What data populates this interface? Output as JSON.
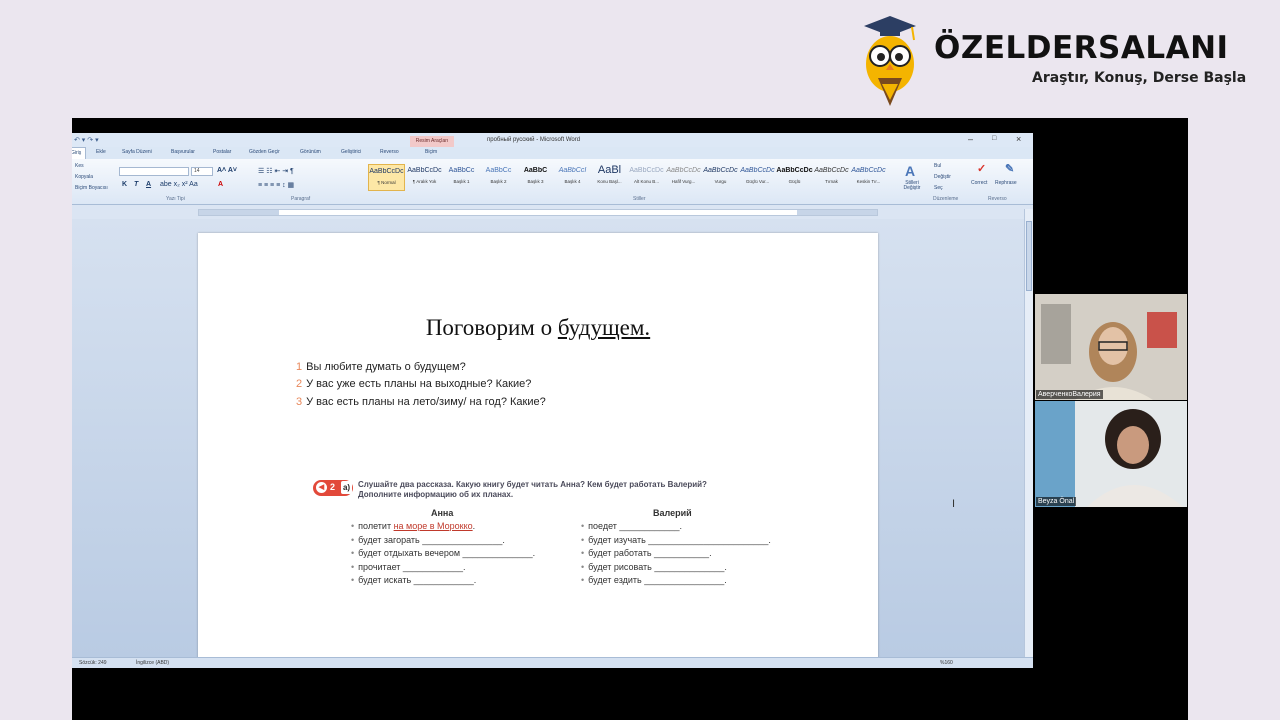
{
  "brand": {
    "name": "ÖZELDERSALANI",
    "tagline": "Araştır, Konuş, Derse Başla"
  },
  "word": {
    "title": "пробный русский - Microsoft Word",
    "context_tab": "Resim Araçları",
    "tabs": [
      "Giriş",
      "Ekle",
      "Sayfa Düzeni",
      "Başvurular",
      "Postalar",
      "Gözden Geçir",
      "Görünüm",
      "Geliştirici",
      "Reverso",
      "Biçim"
    ],
    "clipboard": [
      "Kes",
      "Kopyala",
      "Biçim Boyacısı"
    ],
    "font_size": "14",
    "groups": [
      "Yazı Tipi",
      "Paragraf",
      "Stiller",
      "Düzenleme",
      "Reverso"
    ],
    "styles": [
      {
        "sample": "AaBbCcDc",
        "name": "¶ Normal"
      },
      {
        "sample": "AaBbCcDc",
        "name": "¶ Aralık Yok"
      },
      {
        "sample": "AaBbCc",
        "name": "Başlık 1"
      },
      {
        "sample": "AaBbCc",
        "name": "Başlık 2"
      },
      {
        "sample": "AaBbC",
        "name": "Başlık 3"
      },
      {
        "sample": "AaBbCcI",
        "name": "Başlık 4"
      },
      {
        "sample": "AaBl",
        "name": "Konu Başl..."
      },
      {
        "sample": "AaBbCcDc",
        "name": "Alt Konu B..."
      },
      {
        "sample": "AaBbCcDc",
        "name": "Hafif Vurg..."
      },
      {
        "sample": "AaBbCcDc",
        "name": "Vurgu"
      },
      {
        "sample": "AaBbCcDc",
        "name": "Güçlü Vur..."
      },
      {
        "sample": "AaBbCcDc",
        "name": "Güçlü"
      },
      {
        "sample": "AaBbCcDc",
        "name": "Tırnak"
      },
      {
        "sample": "AaBbCcDc",
        "name": "Keskin Tır..."
      }
    ],
    "change_styles": "Stilleri Değiştir",
    "editing": [
      "Bul",
      "Değiştir",
      "Seç"
    ],
    "reverso": [
      "Correct",
      "Rephrase"
    ],
    "status": {
      "words": "Sözcük: 249",
      "language": "İngilizce (ABD)",
      "zoom": "%160"
    }
  },
  "document": {
    "title_plain": "Поговорим о ",
    "title_underlined": "будущем.",
    "questions": [
      {
        "n": "1",
        "text": "Вы любите думать о будущем?"
      },
      {
        "n": "2",
        "text": "У вас уже есть планы на выходные? Какие?"
      },
      {
        "n": "3",
        "text": "У вас есть планы на лето/зиму/ на год? Какие?"
      }
    ],
    "exercise": {
      "number": "2",
      "letter": "а)",
      "line1": "Слушайте два рассказа. Какую книгу будет читать Анна? Кем будет работать Валерий?",
      "line2": "Дополните информацию об их планах."
    },
    "anna": {
      "heading": "Анна",
      "first_prefix": "полетит ",
      "first_red": "на море в Морокко",
      "first_suffix": ".",
      "items": [
        "будет загорать ________________.",
        "будет отдыхать вечером ______________.",
        "прочитает ____________.",
        "будет искать ____________."
      ]
    },
    "valery": {
      "heading": "Валерий",
      "items": [
        "поедет ____________.",
        "будет изучать ________________________.",
        "будет работать ___________.",
        "будет рисовать ______________.",
        "будет ездить ________________."
      ]
    }
  },
  "participants": [
    "АверченкоВалерия",
    "Beyza Önal"
  ]
}
